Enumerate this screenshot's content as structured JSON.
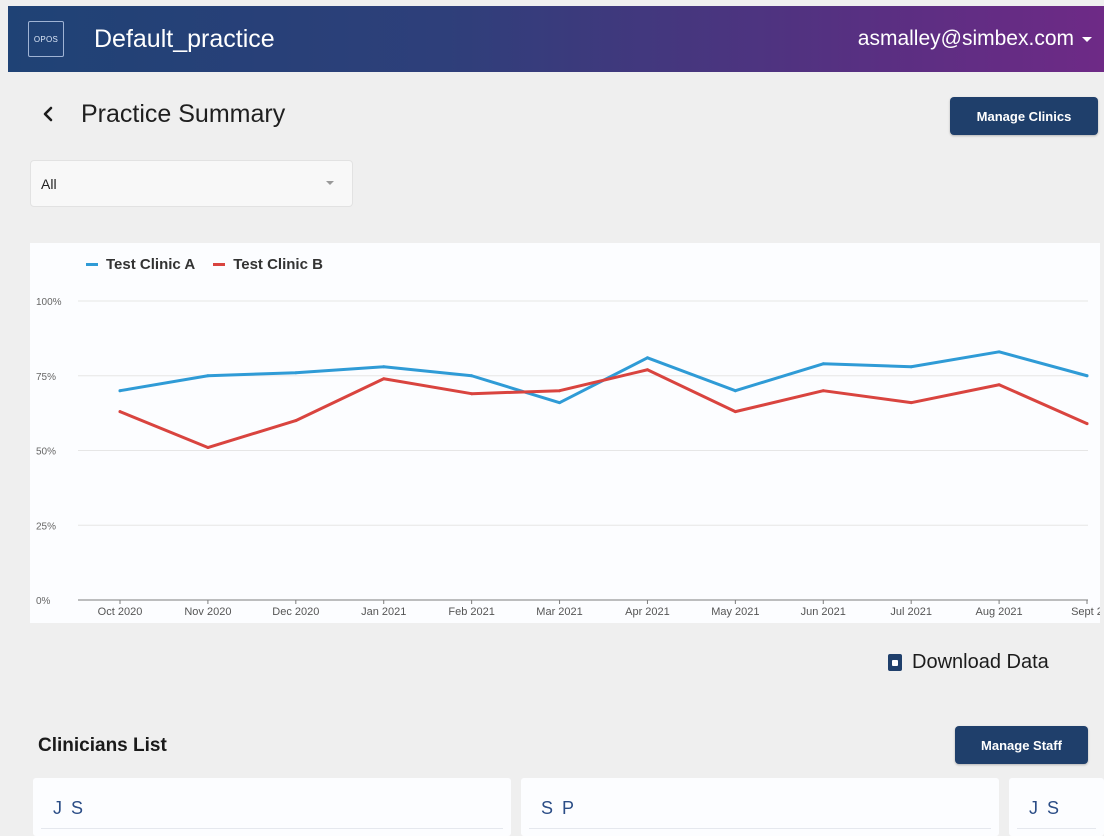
{
  "header": {
    "logo_text": "OPOS",
    "app_title": "Default_practice",
    "user_email": "asmalley@simbex.com"
  },
  "page": {
    "title": "Practice Summary",
    "manage_clinics_label": "Manage Clinics"
  },
  "filter": {
    "selected": "All"
  },
  "chart_data": {
    "type": "line",
    "x": [
      "Oct 2020",
      "Nov 2020",
      "Dec 2020",
      "Jan 2021",
      "Feb 2021",
      "Mar 2021",
      "Apr 2021",
      "May 2021",
      "Jun 2021",
      "Jul 2021",
      "Aug 2021",
      "Sept 2"
    ],
    "y_ticks": [
      "100%",
      "75%",
      "50%",
      "25%",
      "0%"
    ],
    "ylim": [
      0,
      100
    ],
    "grid": true,
    "legend_position": "top-left",
    "series": [
      {
        "name": "Test Clinic A",
        "color": "#2f9bd6",
        "values": [
          70,
          75,
          76,
          78,
          75,
          66,
          81,
          70,
          79,
          78,
          83,
          75
        ]
      },
      {
        "name": "Test Clinic B",
        "color": "#d9443f",
        "values": [
          63,
          51,
          60,
          74,
          69,
          70,
          77,
          63,
          70,
          66,
          72,
          59
        ]
      }
    ]
  },
  "download": {
    "label": "Download Data",
    "icon": "download-icon"
  },
  "clinicians": {
    "title": "Clinicians List",
    "manage_staff_label": "Manage Staff",
    "cards": [
      {
        "initials": "J S"
      },
      {
        "initials": "S P"
      },
      {
        "initials": "J S"
      }
    ]
  }
}
